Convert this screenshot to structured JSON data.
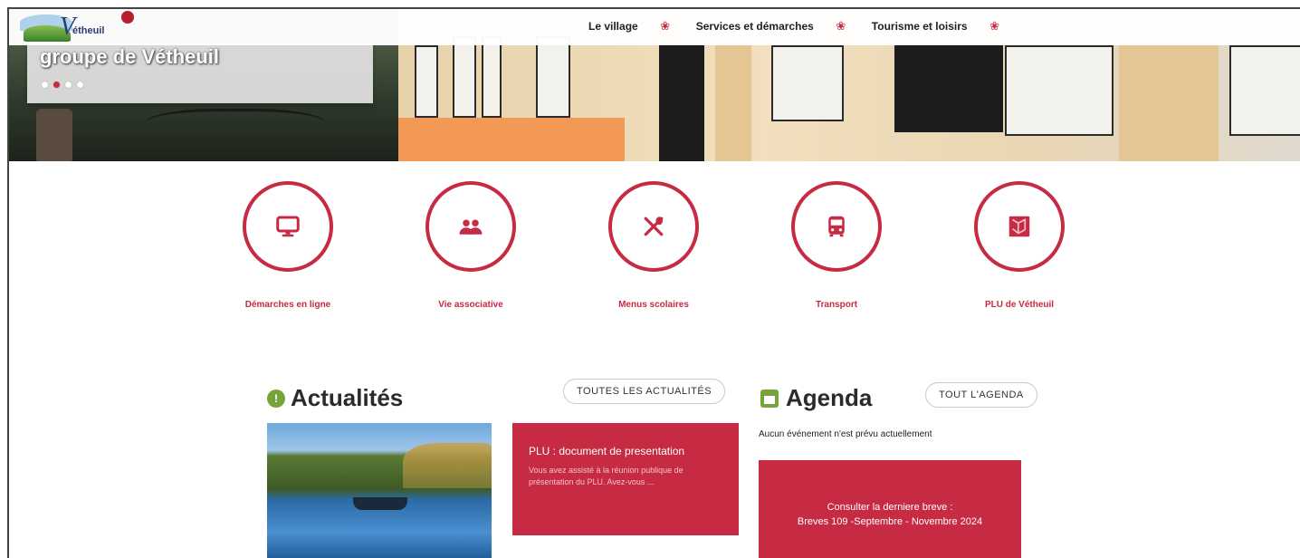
{
  "header": {
    "logo_text": "étheuil",
    "logo_initial": "V",
    "nav": [
      {
        "label": "Le village"
      },
      {
        "label": "Services et démarches"
      },
      {
        "label": "Tourisme et loisirs"
      }
    ]
  },
  "hero": {
    "title": "groupe de Vétheuil",
    "slides": 4,
    "active_slide": 2
  },
  "quick_links": [
    {
      "label": "Démarches en ligne",
      "icon": "monitor-icon"
    },
    {
      "label": "Vie associative",
      "icon": "people-icon"
    },
    {
      "label": "Menus scolaires",
      "icon": "cutlery-icon"
    },
    {
      "label": "Transport",
      "icon": "bus-icon"
    },
    {
      "label": "PLU de Vétheuil",
      "icon": "map-icon"
    }
  ],
  "news": {
    "title": "Actualités",
    "all_button": "TOUTES LES ACTUALITÉS",
    "card_title": "PLU : document de presentation",
    "card_excerpt": "Vous avez assisté à la réunion publique de présentation du PLU. Avez-vous ..."
  },
  "agenda": {
    "title": "Agenda",
    "all_button": "TOUT L'AGENDA",
    "empty_text": "Aucun événement n'est prévu actuellement",
    "breve_line1": "Consulter la derniere breve :",
    "breve_line2": "Breves 109 -Septembre - Novembre 2024"
  },
  "colors": {
    "accent": "#c72a43",
    "green": "#77a43a"
  }
}
